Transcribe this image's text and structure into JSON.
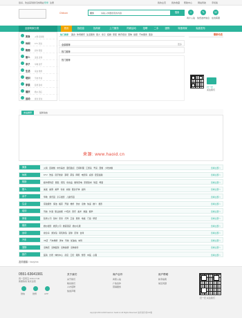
{
  "topbar": {
    "welcome": "您好，欢迎来到我们的网站！",
    "login": "登录",
    "register": "注册",
    "right": [
      "我的主页",
      "我的收藏",
      "帮助中心",
      "网站导航",
      "手机版"
    ]
  },
  "header": {
    "city": "Chibom",
    "search_select": "服务",
    "search_placeholder": "请输入你要搜索的内容",
    "search_button": "搜索",
    "quick": [
      {
        "label": "商户入驻"
      },
      {
        "label": "免费发布信息"
      },
      {
        "label": "在线客服"
      }
    ]
  },
  "nav": {
    "all": "全部商家分类",
    "items": [
      "首页",
      "找信息",
      "找商家",
      "上门服务",
      "同城活动",
      "招聘",
      "二手",
      "团购",
      "特惠商家",
      "免费发布"
    ]
  },
  "sidebar": [
    {
      "name": "美食",
      "sub": "火锅 自助餐"
    },
    {
      "name": "休闲",
      "sub": "KTV 洗浴"
    },
    {
      "name": "购物",
      "sub": "超市 服装"
    },
    {
      "name": "丽人",
      "sub": "美发 美容"
    },
    {
      "name": "亲子",
      "sub": "早教 游乐"
    },
    {
      "name": "生活",
      "sub": "家政 维修"
    },
    {
      "name": "培训",
      "sub": "驾校 外语"
    },
    {
      "name": "家装",
      "sub": "装修 建材"
    },
    {
      "name": "婚庆",
      "sub": "婚纱 酒店"
    },
    {
      "name": "运动",
      "sub": "健身 游泳"
    }
  ],
  "tabs": [
    "热门商家",
    "美食",
    "休闲娱乐",
    "生活服务",
    "丽人",
    "亲子",
    "结婚",
    "家装",
    "教育培训",
    "宠物",
    "健康",
    "汽车服务",
    "更多"
  ],
  "bars": [
    {
      "title": "全部推荐",
      "right": "更多"
    },
    {
      "title": "热门推荐",
      "right": ""
    },
    {
      "title": "热门推荐",
      "right": ""
    }
  ],
  "side_right": {
    "title": "最新动态",
    "qr_caption": "扫一扫",
    "qr_caption2": "关注我们"
  },
  "mid": {
    "tab_active": "本站推荐",
    "tab_other": "最新动态"
  },
  "watermark": "来源: www.haoid.cn",
  "categories": [
    {
      "label": "美食",
      "items": "火锅 自助餐 中外美食 面包甜点 日韩料理 江浙菜 粤菜 西餐 小吃快餐",
      "more": "查看全部 >"
    },
    {
      "label": "休闲",
      "items": "KTV 洗浴 足疗按摩 酒吧 茶馆 网吧 电影院 桌游 密室逃脱",
      "more": "查看全部 >"
    },
    {
      "label": "购物",
      "items": "超市便利店 服装 鞋包 化妆品 数码家电 家居建材 珠宝 母婴",
      "more": "查看全部 >"
    },
    {
      "label": "丽人",
      "items": "美发 美容 美甲 化妆 瑜伽 瘦身纤体 齿科",
      "more": "查看全部 >"
    },
    {
      "label": "亲子",
      "items": "早教 游乐园 亲子摄影 儿童乐园",
      "more": "查看全部 >"
    },
    {
      "label": "生活",
      "items": "家政服务 保洁 搬家 开锁 维修 洗衣 宠物 快递 婚介 摄影",
      "more": "查看全部 >"
    },
    {
      "label": "培训",
      "items": "驾校 外语 职业技能 IT培训 音乐 美术 舞蹈 留学",
      "more": "查看全部 >"
    },
    {
      "label": "家装",
      "items": "装修公司 建材 家具 灯饰 卫浴 厨具 地板 门窗 壁纸",
      "more": "查看全部 >"
    },
    {
      "label": "婚庆",
      "items": "婚纱摄影 婚庆公司 婚宴酒店 婚纱礼服",
      "more": "查看全部 >"
    },
    {
      "label": "运动",
      "items": "健身房 游泳馆 羽毛球馆 篮球 足球 台球",
      "more": "查看全部 >"
    },
    {
      "label": "汽车",
      "items": "4S店 汽车维修 洗车 驾校 加油站 车险",
      "more": "查看全部 >"
    },
    {
      "label": "宠物",
      "items": "宠物店 宠物医院 宠物美容 宠物寄养",
      "more": "查看全部 >"
    },
    {
      "label": "医疗",
      "items": "医院 诊所 体检中心 药店 口腔 眼科 整形 中医 心理",
      "more": "查看全部 >"
    },
    {
      "label": "其他",
      "items": "酒店住宿 旅游 景点 ",
      "more": "查看全部 >"
    }
  ],
  "friend_links": {
    "title": "友情链接",
    "text": "/ haoyima"
  },
  "footer": {
    "phone": "0551-63641901",
    "lines": [
      "周一至周五 9:00-17:30",
      "客服热线 免长途费"
    ],
    "cols": [
      {
        "h": "关于我们",
        "items": [
          "关于我们",
          "联系我们",
          "人才招聘",
          "免责声明"
        ]
      },
      {
        "h": "商户合作",
        "items": [
          "商家入驻",
          "广告合作",
          "营销服务"
        ]
      },
      {
        "h": "用户帮助",
        "items": [
          "新手指南",
          "常见问题"
        ]
      }
    ],
    "icons": [
      "微信",
      "微博",
      "APP"
    ],
    "qr_caption": "扫一扫 关注我们",
    "copyright": "copyright 2013-2019 haoid.cn haoid.cn All Rights Reserved. 技术支持 皖ICP备"
  }
}
